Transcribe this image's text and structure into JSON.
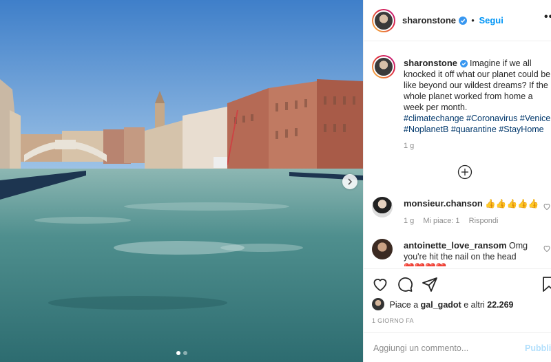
{
  "post": {
    "author": "sharonstone",
    "follow_label": "Segui",
    "separator": "•",
    "more_label": "•••",
    "caption_text": "Imagine if we all knocked it off what our planet could be like beyond our wildest dreams? If the whole planet worked from home a week per month.",
    "hashtags": [
      "#climatechange",
      "#Coronavirus",
      "#Venice",
      "#NoplanetB",
      "#quarantine",
      "#StayHome"
    ],
    "caption_time": "1 g",
    "carousel": {
      "count": 2,
      "active_index": 0
    }
  },
  "comments": [
    {
      "username": "monsieur.chanson",
      "text": "👍👍👍👍👍",
      "time": "1 g",
      "likes_label": "Mi piace: 1",
      "reply_label": "Rispondi"
    },
    {
      "username": "antoinette_love_ransom",
      "text": "Omg you're hit the nail on the head",
      "extra": "❤️❤️❤️❤️"
    }
  ],
  "actions": {
    "likes_prefix": "Piace a",
    "liked_by": "gal_gadot",
    "likes_suffix": "e altri",
    "likes_count": "22.269",
    "date": "1 GIORNO FA"
  },
  "add_comment": {
    "placeholder": "Aggiungi un commento...",
    "publish_label": "Pubblica"
  },
  "icons": [
    "verified-icon",
    "heart-icon",
    "comment-icon",
    "share-icon",
    "bookmark-icon",
    "load-more-icon",
    "chevron-right-icon"
  ],
  "colors": {
    "link": "#0095f6",
    "hashtag": "#00376b",
    "muted": "#8e8e8e",
    "publish_disabled": "#b2dffc"
  }
}
